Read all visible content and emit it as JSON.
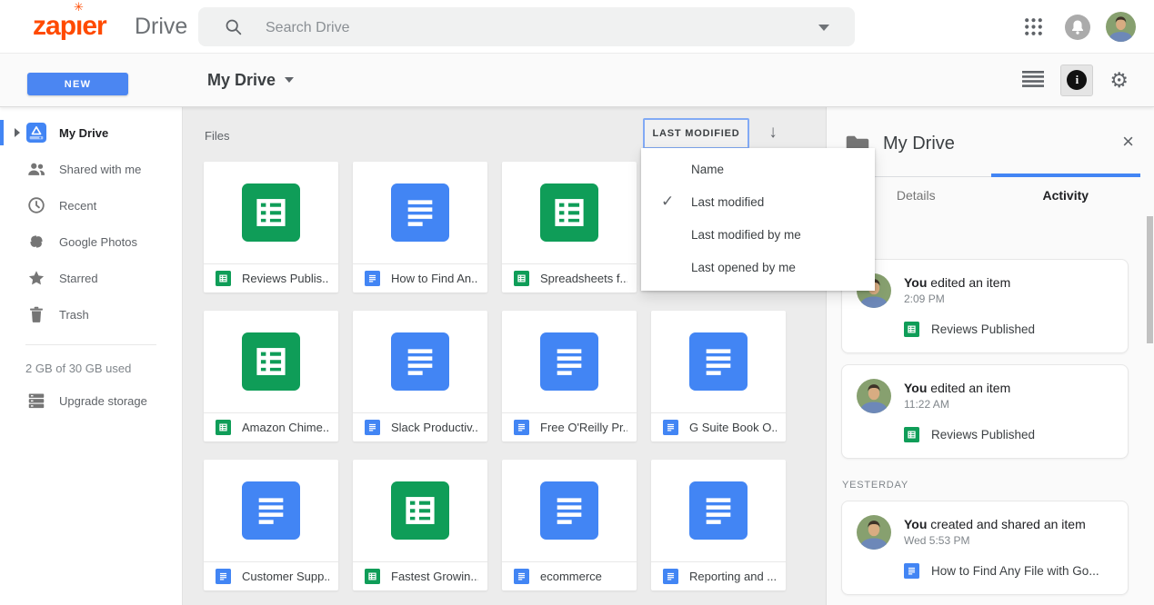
{
  "topbar": {
    "logo": "zapier",
    "app_name": "Drive",
    "search": {
      "placeholder": "Search Drive"
    }
  },
  "toolbar": {
    "new_button": "NEW",
    "breadcrumb": "My Drive"
  },
  "sidebar": {
    "items": [
      {
        "label": "My Drive",
        "icon": "drive-icon",
        "selected": true
      },
      {
        "label": "Shared with me",
        "icon": "people-icon",
        "selected": false
      },
      {
        "label": "Recent",
        "icon": "clock-icon",
        "selected": false
      },
      {
        "label": "Google Photos",
        "icon": "photos-icon",
        "selected": false
      },
      {
        "label": "Starred",
        "icon": "star-icon",
        "selected": false
      },
      {
        "label": "Trash",
        "icon": "trash-icon",
        "selected": false
      }
    ],
    "storage_text": "2 GB of 30 GB used",
    "upgrade_label": "Upgrade storage"
  },
  "main": {
    "files_label": "Files",
    "sort_button": "LAST MODIFIED",
    "sort_direction_icon": "arrow-down",
    "sort_menu": {
      "items": [
        {
          "label": "Name",
          "checked": false
        },
        {
          "label": "Last modified",
          "checked": true
        },
        {
          "label": "Last modified by me",
          "checked": false
        },
        {
          "label": "Last opened by me",
          "checked": false
        }
      ]
    },
    "file_rows": [
      [
        {
          "name": "Reviews Publis...",
          "type": "sheet"
        },
        {
          "name": "How to Find An...",
          "type": "doc"
        },
        {
          "name": "Spreadsheets f...",
          "type": "sheet"
        }
      ],
      [
        {
          "name": "Amazon Chime...",
          "type": "sheet"
        },
        {
          "name": "Slack Productiv...",
          "type": "doc"
        },
        {
          "name": "Free O'Reilly Pr...",
          "type": "doc"
        },
        {
          "name": "G Suite Book O...",
          "type": "doc"
        }
      ],
      [
        {
          "name": "Customer Supp...",
          "type": "doc"
        },
        {
          "name": "Fastest Growin...",
          "type": "sheet"
        },
        {
          "name": "ecommerce",
          "type": "doc"
        },
        {
          "name": "Reporting and ...",
          "type": "doc"
        }
      ]
    ]
  },
  "panel": {
    "title": "My Drive",
    "tabs": [
      {
        "label": "Details",
        "active": false
      },
      {
        "label": "Activity",
        "active": true
      }
    ],
    "activity": {
      "sections": [
        {
          "header": "",
          "items": [
            {
              "actor": "You",
              "action": "edited an item",
              "time": "2:09 PM",
              "file": {
                "name": "Reviews Published",
                "type": "sheet"
              }
            },
            {
              "actor": "You",
              "action": "edited an item",
              "time": "11:22 AM",
              "file": {
                "name": "Reviews Published",
                "type": "sheet"
              }
            }
          ]
        },
        {
          "header": "YESTERDAY",
          "items": [
            {
              "actor": "You",
              "action": "created and shared an item",
              "time": "Wed 5:53 PM",
              "file": {
                "name": "How to Find Any File with Go...",
                "type": "doc"
              }
            }
          ]
        }
      ]
    }
  },
  "colors": {
    "zapier_orange": "#ff4a00",
    "google_blue": "#4285f4",
    "sheets_green": "#0f9d58",
    "docs_blue": "#4285f4",
    "active_tab_underline": "#4285f4"
  }
}
